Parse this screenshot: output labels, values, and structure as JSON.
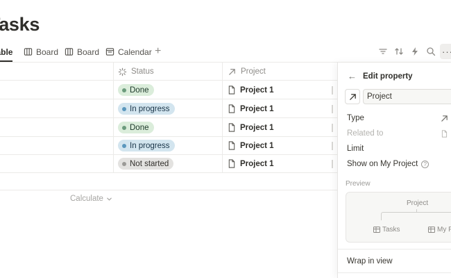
{
  "page": {
    "title": "Tasks"
  },
  "views": {
    "tabs": [
      {
        "label": "Table",
        "icon": "table-icon",
        "active": true
      },
      {
        "label": "Board",
        "icon": "board-icon"
      },
      {
        "label": "Board",
        "icon": "board-icon"
      },
      {
        "label": "Calendar",
        "icon": "calendar-icon"
      }
    ],
    "add_label": "+"
  },
  "toolbar": {
    "icons": [
      "filter-icon",
      "sort-icon",
      "automation-icon",
      "search-icon",
      "more-icon"
    ],
    "more_label": "···"
  },
  "table": {
    "columns": [
      {
        "label": "Status",
        "icon": "status-icon"
      },
      {
        "label": "Project",
        "icon": "relation-arrow-icon"
      }
    ],
    "rows": [
      {
        "status": "Done",
        "project": "Project 1"
      },
      {
        "status": "In progress",
        "project": "Project 1"
      },
      {
        "status": "Done",
        "project": "Project 1"
      },
      {
        "status": "In progress",
        "project": "Project 1"
      },
      {
        "status": "Not started",
        "project": "Project 1"
      }
    ],
    "calculate_label": "Calculate"
  },
  "status_colors": {
    "Done": "#dbeddb",
    "In progress": "#d3e5ef",
    "Not started": "#e3e2e0"
  },
  "panel": {
    "title": "Edit property",
    "back_icon": "arrow-left-icon",
    "property_name": "Project",
    "type_label": "Type",
    "related_to_label": "Related to",
    "limit_label": "Limit",
    "show_on_label": "Show on My Project",
    "preview_label": "Preview",
    "preview": {
      "project": "Project",
      "left_node": "Tasks",
      "right_node": "My P"
    },
    "wrap_label": "Wrap in view"
  }
}
